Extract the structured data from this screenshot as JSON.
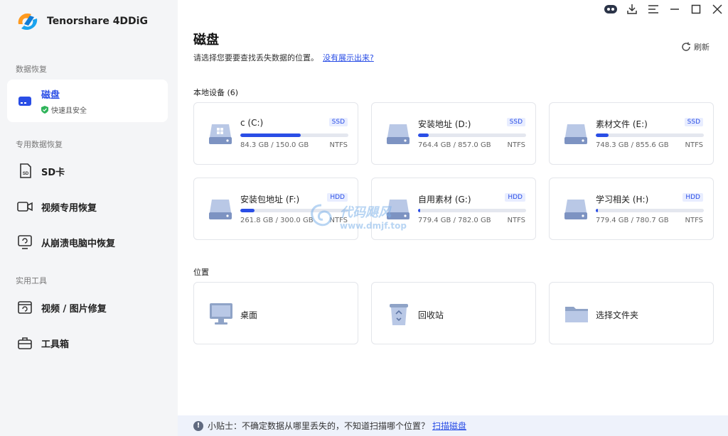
{
  "app": {
    "name": "Tenorshare 4DDiG"
  },
  "sidebar": {
    "sections": [
      {
        "label": "数据恢复"
      },
      {
        "label": "专用数据恢复"
      },
      {
        "label": "实用工具"
      }
    ],
    "items": [
      {
        "label": "磁盘",
        "sublabel": "快速且安全",
        "icon": "disk-icon"
      },
      {
        "label": "SD卡",
        "icon": "sd-card-icon"
      },
      {
        "label": "视频专用恢复",
        "icon": "video-icon"
      },
      {
        "label": "从崩溃电脑中恢复",
        "icon": "crash-pc-icon"
      },
      {
        "label": "视频 / 图片修复",
        "icon": "repair-icon"
      },
      {
        "label": "工具箱",
        "icon": "toolbox-icon"
      }
    ]
  },
  "main": {
    "title": "磁盘",
    "subtitle": "请选择您要要查找丢失数据的位置。",
    "subtitle_link": "没有展示出来?",
    "refresh_label": "刷新",
    "local_devices_label": "本地设备 (6)",
    "drives": [
      {
        "name": "c (C:)",
        "type": "SSD",
        "size": "84.3 GB / 150.0 GB",
        "fs": "NTFS",
        "used": 0.56,
        "system": true
      },
      {
        "name": "安装地址 (D:)",
        "type": "SSD",
        "size": "764.4 GB / 857.0 GB",
        "fs": "NTFS",
        "used": 0.1,
        "system": false
      },
      {
        "name": "素材文件 (E:)",
        "type": "SSD",
        "size": "748.3 GB / 855.6 GB",
        "fs": "NTFS",
        "used": 0.12,
        "system": false
      },
      {
        "name": "安装包地址 (F:)",
        "type": "HDD",
        "size": "261.8 GB / 300.0 GB",
        "fs": "NTFS",
        "used": 0.13,
        "system": false
      },
      {
        "name": "自用素材 (G:)",
        "type": "HDD",
        "size": "779.4 GB / 782.0 GB",
        "fs": "NTFS",
        "used": 0.01,
        "system": false
      },
      {
        "name": "学习相关 (H:)",
        "type": "HDD",
        "size": "779.4 GB / 780.7 GB",
        "fs": "NTFS",
        "used": 0.01,
        "system": false
      }
    ],
    "locations_label": "位置",
    "locations": [
      {
        "name": "桌面",
        "icon": "desktop-icon"
      },
      {
        "name": "回收站",
        "icon": "recycle-bin-icon"
      },
      {
        "name": "选择文件夹",
        "icon": "folder-icon"
      }
    ]
  },
  "tip": {
    "text": "小贴士：不确定数据从哪里丢失的，不知道扫描哪个位置？",
    "link": "扫描磁盘"
  },
  "watermark": {
    "title": "代码飓风",
    "url": "www.dmjf.top"
  },
  "colors": {
    "accent": "#2a4ee6",
    "sidebar_bg": "#f4f5f7",
    "tip_bg": "#eef2fb"
  }
}
